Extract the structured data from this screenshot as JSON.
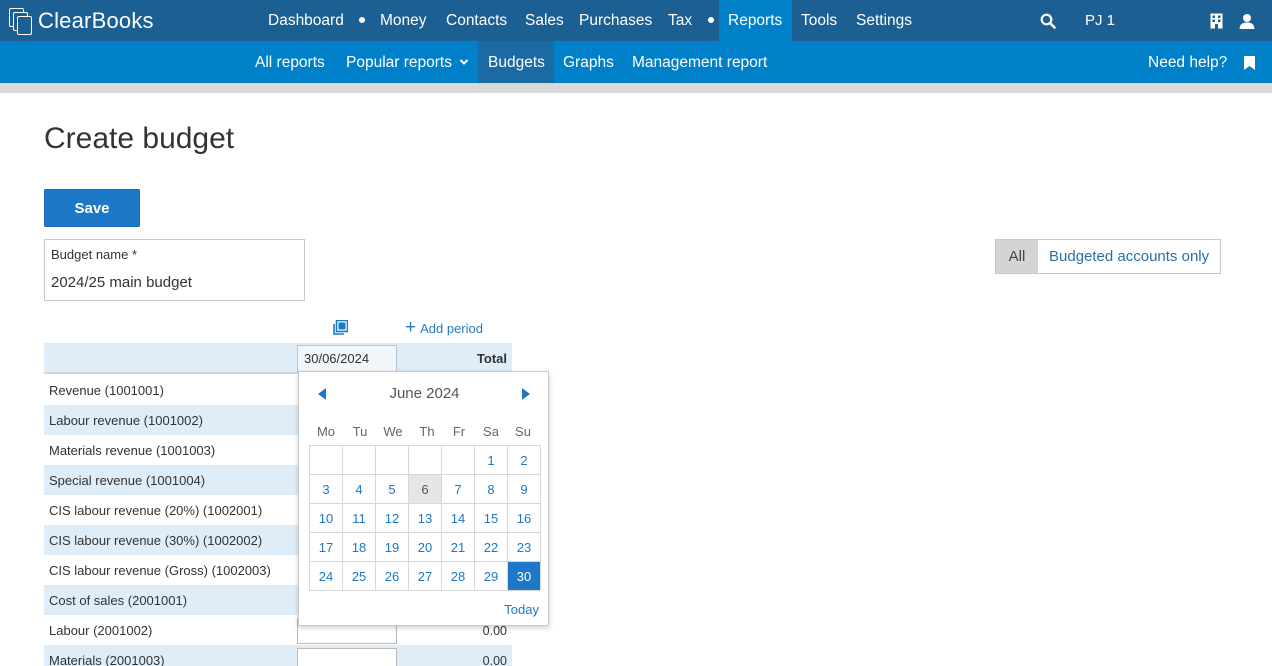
{
  "brand": {
    "name": "ClearBooks"
  },
  "topnav": {
    "items": [
      "Dashboard",
      "Money",
      "Contacts",
      "Sales",
      "Purchases",
      "Tax",
      "Reports",
      "Tools",
      "Settings"
    ],
    "active": "Reports",
    "user": "PJ 1"
  },
  "subnav": {
    "items": [
      "All reports",
      "Popular reports",
      "Budgets",
      "Graphs",
      "Management report"
    ],
    "active": "Budgets",
    "help": "Need help?"
  },
  "page": {
    "title": "Create budget",
    "save_label": "Save",
    "budget_name_label": "Budget name *",
    "budget_name_value": "2024/25 main budget",
    "filter_all": "All",
    "filter_budgeted": "Budgeted accounts only",
    "add_period": "Add period"
  },
  "grid": {
    "period_date": "30/06/2024",
    "total_header": "Total",
    "rows": [
      {
        "label": "Revenue (1001001)",
        "total": ""
      },
      {
        "label": "Labour revenue (1001002)",
        "total": ""
      },
      {
        "label": "Materials revenue (1001003)",
        "total": ""
      },
      {
        "label": "Special revenue (1001004)",
        "total": ""
      },
      {
        "label": "CIS labour revenue (20%) (1002001)",
        "total": ""
      },
      {
        "label": "CIS labour revenue (30%) (1002002)",
        "total": ""
      },
      {
        "label": "CIS labour revenue (Gross) (1002003)",
        "total": ""
      },
      {
        "label": "Cost of sales (2001001)",
        "total": ""
      },
      {
        "label": "Labour (2001002)",
        "total": "0.00"
      },
      {
        "label": "Materials (2001003)",
        "total": "0.00"
      }
    ]
  },
  "datepicker": {
    "month_label": "June 2024",
    "weekdays": [
      "Mo",
      "Tu",
      "We",
      "Th",
      "Fr",
      "Sa",
      "Su"
    ],
    "weeks": [
      [
        "",
        "",
        "",
        "",
        "",
        "1",
        "2"
      ],
      [
        "3",
        "4",
        "5",
        "6",
        "7",
        "8",
        "9"
      ],
      [
        "10",
        "11",
        "12",
        "13",
        "14",
        "15",
        "16"
      ],
      [
        "17",
        "18",
        "19",
        "20",
        "21",
        "22",
        "23"
      ],
      [
        "24",
        "25",
        "26",
        "27",
        "28",
        "29",
        "30"
      ]
    ],
    "today_day": "6",
    "selected_day": "30",
    "today_label": "Today"
  },
  "colors": {
    "topbar": "#1b5f93",
    "subbar": "#0080c9",
    "accent": "#1d78c8",
    "row_shade": "#deedf8"
  }
}
